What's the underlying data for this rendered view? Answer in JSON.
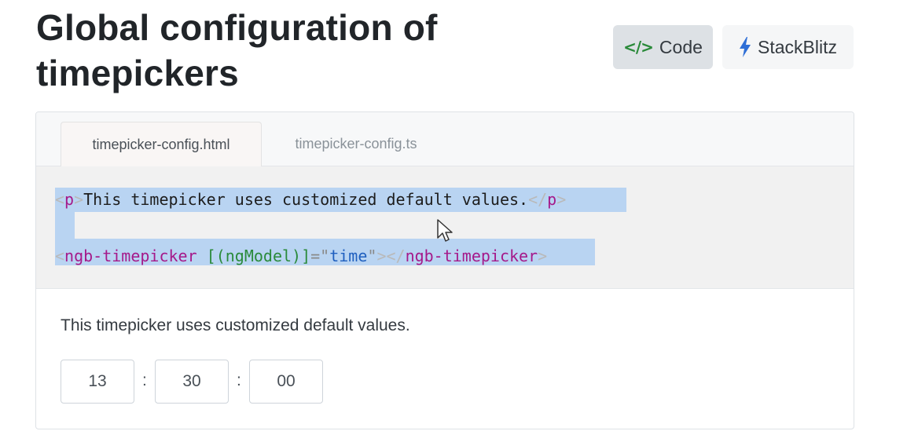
{
  "header": {
    "title": "Global configuration of timepickers",
    "code_button": {
      "label": "Code",
      "icon": "code-icon"
    },
    "stackblitz_button": {
      "label": "StackBlitz",
      "icon": "bolt-icon"
    }
  },
  "tabs": [
    {
      "label": "timepicker-config.html",
      "active": true
    },
    {
      "label": "timepicker-config.ts",
      "active": false
    }
  ],
  "code": {
    "line1": {
      "open_tag": "p",
      "text": "This timepicker uses customized default values.",
      "close_tag": "p"
    },
    "line3": {
      "tag": "ngb-timepicker",
      "attr": "[(ngModel)]",
      "value": "time"
    }
  },
  "demo": {
    "text": "This timepicker uses customized default values.",
    "timepicker": {
      "hours": "13",
      "minutes": "30",
      "seconds": "00",
      "separator": ":"
    }
  },
  "colors": {
    "selection": "#b9d4f2",
    "tag": "#a5198a",
    "attr": "#2a8a3a",
    "string": "#1f5fbf",
    "code_button_bg": "#dde1e5",
    "bolt": "#2f6fd6"
  }
}
